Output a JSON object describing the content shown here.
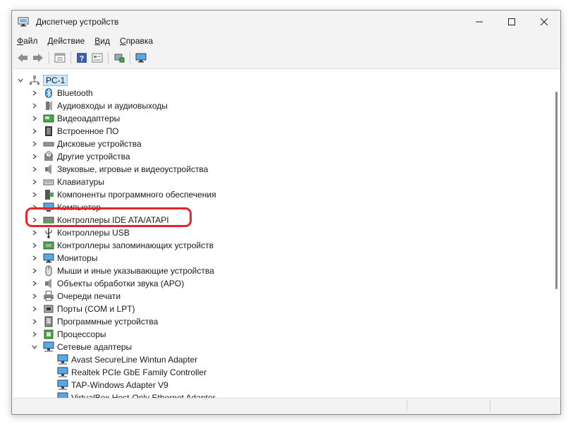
{
  "window": {
    "title": "Диспетчер устройств"
  },
  "menu": [
    {
      "pre": "",
      "ul": "Ф",
      "post": "айл"
    },
    {
      "pre": "",
      "ul": "Д",
      "post": "ействие"
    },
    {
      "pre": "",
      "ul": "В",
      "post": "ид"
    },
    {
      "pre": "",
      "ul": "С",
      "post": "правка"
    }
  ],
  "toolbar": {
    "icons": [
      "back-icon",
      "forward-icon",
      "properties-icon",
      "help-icon",
      "view-icon",
      "scan-hardware-icon",
      "monitor-icon"
    ]
  },
  "tree": {
    "root": "PC-1",
    "categories": [
      {
        "label": "Bluetooth",
        "icon": "bluetooth-icon"
      },
      {
        "label": "Аудиовходы и аудиовыходы",
        "icon": "audio-io-icon"
      },
      {
        "label": "Видеоадаптеры",
        "icon": "display-adapter-icon"
      },
      {
        "label": "Встроенное ПО",
        "icon": "firmware-icon"
      },
      {
        "label": "Дисковые устройства",
        "icon": "disk-icon"
      },
      {
        "label": "Другие устройства",
        "icon": "unknown-device-icon"
      },
      {
        "label": "Звуковые, игровые и видеоустройства",
        "icon": "sound-icon"
      },
      {
        "label": "Клавиатуры",
        "icon": "keyboard-icon"
      },
      {
        "label": "Компоненты программного обеспечения",
        "icon": "software-component-icon"
      },
      {
        "label": "Компьютер",
        "icon": "computer-icon"
      },
      {
        "label": "Контроллеры IDE ATA/ATAPI",
        "icon": "ide-controller-icon"
      },
      {
        "label": "Контроллеры USB",
        "icon": "usb-icon"
      },
      {
        "label": "Контроллеры запоминающих устройств",
        "icon": "storage-controller-icon"
      },
      {
        "label": "Мониторы",
        "icon": "monitor-icon"
      },
      {
        "label": "Мыши и иные указывающие устройства",
        "icon": "mouse-icon"
      },
      {
        "label": "Объекты обработки звука (APO)",
        "icon": "apo-icon"
      },
      {
        "label": "Очереди печати",
        "icon": "printer-icon"
      },
      {
        "label": "Порты (COM и LPT)",
        "icon": "port-icon"
      },
      {
        "label": "Программные устройства",
        "icon": "software-device-icon"
      },
      {
        "label": "Процессоры",
        "icon": "processor-icon"
      },
      {
        "label": "Сетевые адаптеры",
        "icon": "network-adapter-icon"
      }
    ],
    "network_children": [
      "Avast SecureLine Wintun Adapter",
      "Realtek PCIe GbE Family Controller",
      "TAP-Windows Adapter V9",
      "VirtualBox Host-Only Ethernet Adapter"
    ]
  },
  "highlight_color": "#e0262e",
  "selection_color": "#cce8ff"
}
